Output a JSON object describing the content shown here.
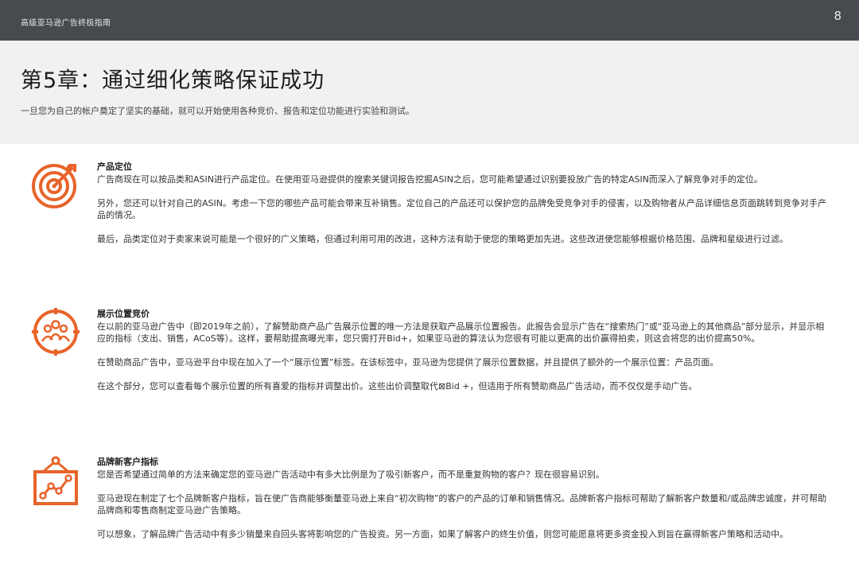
{
  "header": {
    "doc_title": "高级亚马逊广告终极指南",
    "page_number": "8"
  },
  "intro": {
    "title": "第5章：通过细化策略保证成功",
    "lead": "一旦您为自己的帐户奠定了坚实的基础，就可以开始使用各种竞价、报告和定位功能进行实验和测试。"
  },
  "colors": {
    "accent": "#e8632a",
    "header_bg": "#474a4f",
    "intro_bg": "#f1f1f1"
  },
  "sections": [
    {
      "icon": "target-icon",
      "title": "产品定位",
      "paragraphs": [
        "广告商现在可以按品类和ASIN进行产品定位。在使用亚马逊提供的搜索关键词报告挖掘ASIN之后，您可能希望通过识别要投放广告的特定ASIN而深入了解竞争对手的定位。",
        "另外，您还可以针对自己的ASIN。考虑一下您的哪些产品可能会带来互补销售。定位自己的产品还可以保护您的品牌免受竞争对手的侵害，以及购物者从产品详细信息页面跳转到竞争对手产品的情况。",
        "最后，品类定位对于卖家来说可能是一个很好的广义策略，但通过利用可用的改进，这种方法有助于使您的策略更加先进。这些改进使您能够根据价格范围、品牌和星级进行过滤。"
      ]
    },
    {
      "icon": "audience-target-icon",
      "title": "展示位置竞价",
      "paragraphs": [
        "在以前的亚马逊广告中（即2019年之前），了解赞助商产品广告展示位置的唯一方法是获取产品展示位置报告。此报告会显示广告在“搜索热门”或“亚马逊上的其他商品”部分显示，并显示相应的指标（支出、销售，ACoS等）。这样，要帮助提高曝光率，您只需打开Bid+，如果亚马逊的算法认为您很有可能以更高的出价赢得拍卖，则这会将您的出价提高50%。",
        "在赞助商品广告中，亚马逊平台中现在加入了一个“展示位置”标签。在该标签中，亚马逊为您提供了展示位置数据，并且提供了额外的一个展示位置：产品页面。",
        "在这个部分，您可以查看每个展示位置的所有喜爱的指标并调整出价。这些出价调整取代⊠Bid +，但适用于所有赞助商品广告活动，而不仅仅是手动广告。"
      ]
    },
    {
      "icon": "growth-chart-icon",
      "title": "品牌新客户指标",
      "paragraphs": [
        "您是否希望通过简单的方法来确定您的亚马逊广告活动中有多大比例是为了吸引新客户，而不是重复购物的客户？现在很容易识别。",
        "亚马逊现在制定了七个品牌新客户指标，旨在使广告商能够衡量亚马逊上来自“初次购物”的客户的产品的订单和销售情况。品牌新客户指标可帮助了解新客户数量和/或品牌忠诚度，并可帮助品牌商和零售商制定亚马逊广告策略。",
        "可以想象，了解品牌广告活动中有多少销量来自回头客将影响您的广告投资。另一方面，如果了解客户的终生价值，则您可能愿意将更多资金投入到旨在赢得新客户策略和活动中。"
      ]
    }
  ]
}
